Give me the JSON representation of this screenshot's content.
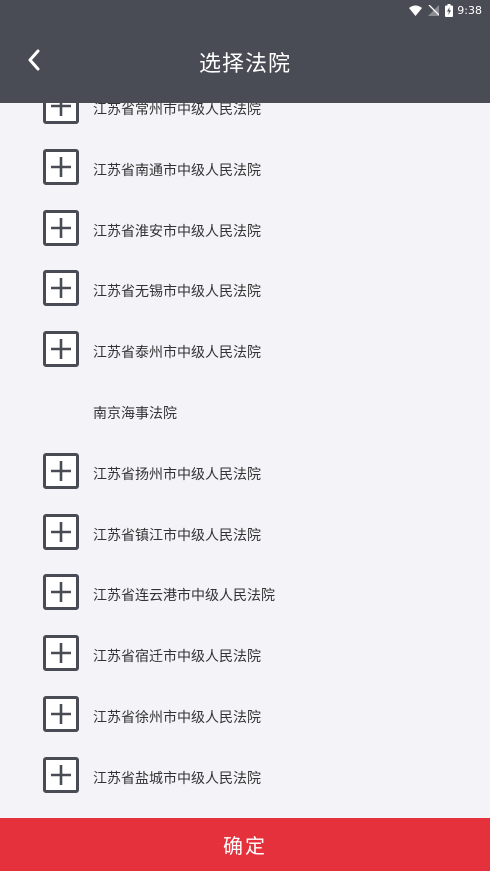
{
  "status_bar": {
    "time": "9:38",
    "icons": [
      "wifi-icon",
      "signal-off-icon",
      "battery-charging-icon"
    ]
  },
  "header": {
    "title": "选择法院",
    "back_icon": "chevron-left-icon"
  },
  "courts": [
    {
      "name": "江苏省常州市中级人民法院",
      "has_children": true
    },
    {
      "name": "江苏省南通市中级人民法院",
      "has_children": true
    },
    {
      "name": "江苏省淮安市中级人民法院",
      "has_children": true
    },
    {
      "name": "江苏省无锡市中级人民法院",
      "has_children": true
    },
    {
      "name": "江苏省泰州市中级人民法院",
      "has_children": true
    },
    {
      "name": "南京海事法院",
      "has_children": false
    },
    {
      "name": "江苏省扬州市中级人民法院",
      "has_children": true
    },
    {
      "name": "江苏省镇江市中级人民法院",
      "has_children": true
    },
    {
      "name": "江苏省连云港市中级人民法院",
      "has_children": true
    },
    {
      "name": "江苏省宿迁市中级人民法院",
      "has_children": true
    },
    {
      "name": "江苏省徐州市中级人民法院",
      "has_children": true
    },
    {
      "name": "江苏省盐城市中级人民法院",
      "has_children": true
    }
  ],
  "confirm": {
    "label": "确定"
  },
  "colors": {
    "header_bg": "#4a4c55",
    "confirm_bg": "#e4313c",
    "list_bg": "#f4f4f8"
  }
}
